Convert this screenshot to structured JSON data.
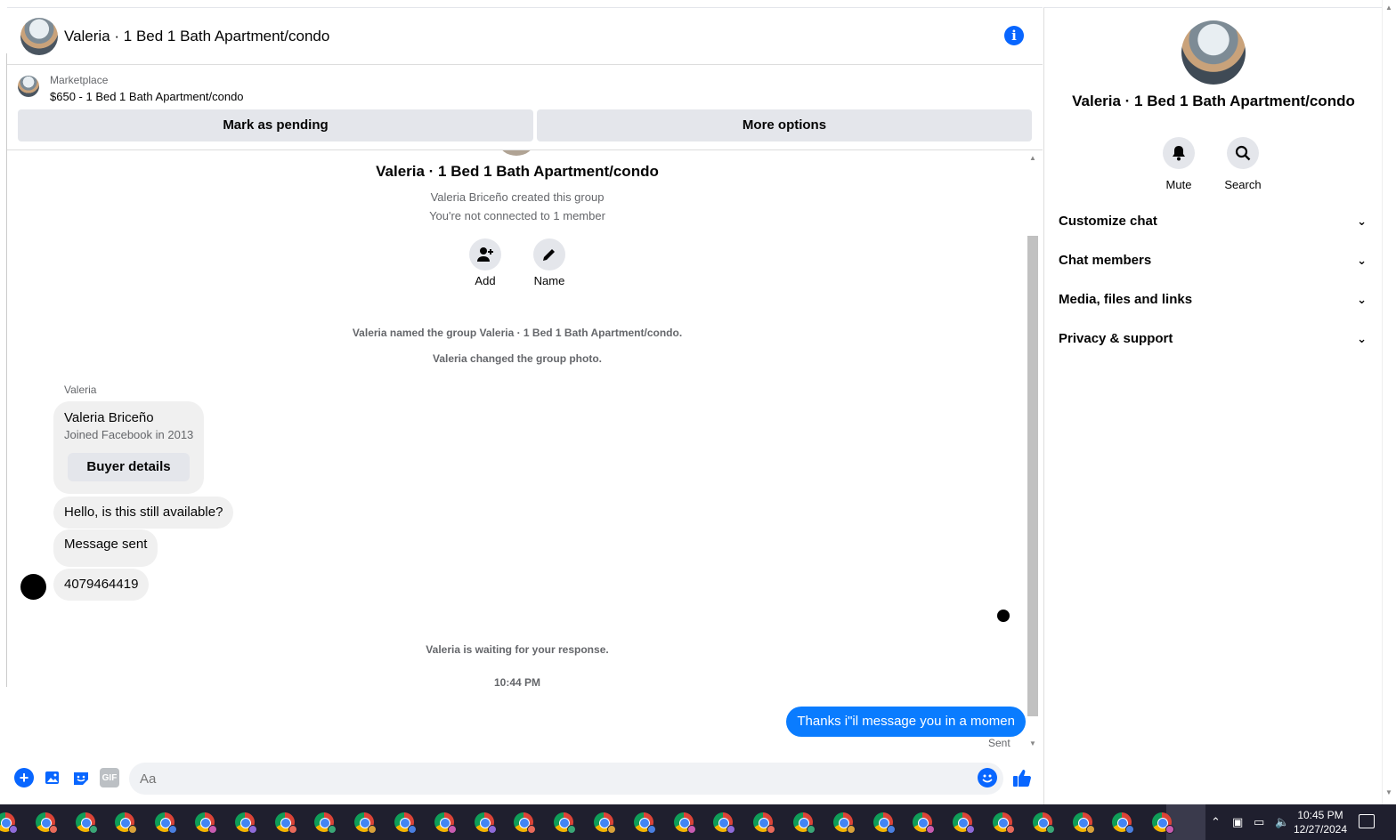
{
  "header": {
    "title": "Valeria · 1 Bed 1 Bath Apartment/condo"
  },
  "marketplace": {
    "label": "Marketplace",
    "listing": "$650 - 1 Bed 1 Bath Apartment/condo",
    "pending_button": "Mark as pending",
    "more_button": "More options"
  },
  "conversation": {
    "group_title": "Valeria · 1 Bed 1 Bath Apartment/condo",
    "created_by": "Valeria Briceño created this group",
    "not_connected": "You're not connected to 1 member",
    "add_label": "Add",
    "name_label": "Name",
    "system_messages": [
      "Valeria named the group Valeria · 1 Bed 1 Bath Apartment/condo.",
      "Valeria changed the group photo."
    ],
    "sender_name": "Valeria",
    "buyer_card": {
      "name": "Valeria Briceño",
      "joined": "Joined Facebook in 2013",
      "button": "Buyer details"
    },
    "incoming": [
      "Hello, is this still available?",
      "Message sent",
      "4079464419"
    ],
    "waiting": "Valeria is waiting for your response.",
    "timestamp": "10:44 PM",
    "outgoing": "Thanks i\"il message you in a momen",
    "sent_status": "Sent"
  },
  "composer": {
    "placeholder": "Aa",
    "gif_label": "GIF"
  },
  "details": {
    "title": "Valeria · 1 Bed 1 Bath Apartment/condo",
    "mute_label": "Mute",
    "search_label": "Search",
    "sections": [
      "Customize chat",
      "Chat members",
      "Media, files and links",
      "Privacy & support"
    ]
  },
  "taskbar": {
    "time": "10:45 PM",
    "date": "12/27/2024",
    "app_count": 30
  },
  "colors": {
    "accent": "#0866ff",
    "outgoing_bubble": "#0a7cff",
    "bubble_gray": "#f0f0f0",
    "taskbar": "#1f1f2e"
  }
}
